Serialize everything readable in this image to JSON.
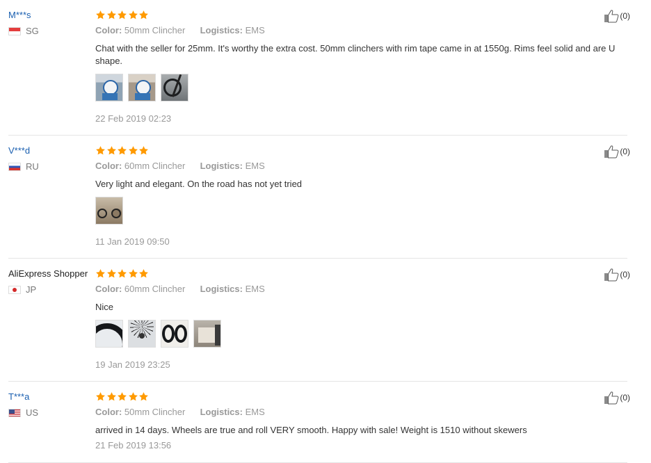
{
  "colors": {
    "username_link": "#1a5fb0",
    "star": "#ff9a00",
    "muted": "#999999",
    "divider": "#e5e5e5"
  },
  "reviews": [
    {
      "user": "M***s",
      "country": "SG",
      "flag_icon": "singapore-flag-icon",
      "rating": 5,
      "color_label": "Color:",
      "color_value": "50mm Clincher",
      "logistics_label": "Logistics:",
      "logistics_value": "EMS",
      "text": "Chat with the seller for 25mm. It's worthy the extra cost. 50mm clinchers with rim tape came in at 1550g. Rims feel solid and are U shape.",
      "photos": [
        "photo-wheel-on-scale",
        "photo-wheel-on-scale",
        "photo-bike-wheel"
      ],
      "date": "22 Feb 2019 02:23",
      "likes": "(0)"
    },
    {
      "user": "V***d",
      "country": "RU",
      "flag_icon": "russia-flag-icon",
      "rating": 5,
      "color_label": "Color:",
      "color_value": "60mm Clincher",
      "logistics_label": "Logistics:",
      "logistics_value": "EMS",
      "text": "Very light and elegant. On the road has not yet tried",
      "photos": [
        "photo-bike"
      ],
      "date": "11 Jan 2019 09:50",
      "likes": "(0)"
    },
    {
      "user": "AliExpress Shopper",
      "country": "JP",
      "flag_icon": "japan-flag-icon",
      "rating": 5,
      "color_label": "Color:",
      "color_value": "60mm Clincher",
      "logistics_label": "Logistics:",
      "logistics_value": "EMS",
      "text": "Nice",
      "photos": [
        "photo-tire",
        "photo-spokes",
        "photo-wheel-pair",
        "photo-package"
      ],
      "date": "19 Jan 2019 23:25",
      "likes": "(0)"
    },
    {
      "user": "T***a",
      "country": "US",
      "flag_icon": "usa-flag-icon",
      "rating": 5,
      "color_label": "Color:",
      "color_value": "50mm Clincher",
      "logistics_label": "Logistics:",
      "logistics_value": "EMS",
      "text": "arrived in 14 days. Wheels are true and roll VERY smooth. Happy with sale! Weight is 1510 without skewers",
      "photos": [],
      "date": "21 Feb 2019 13:56",
      "likes": "(0)"
    }
  ]
}
